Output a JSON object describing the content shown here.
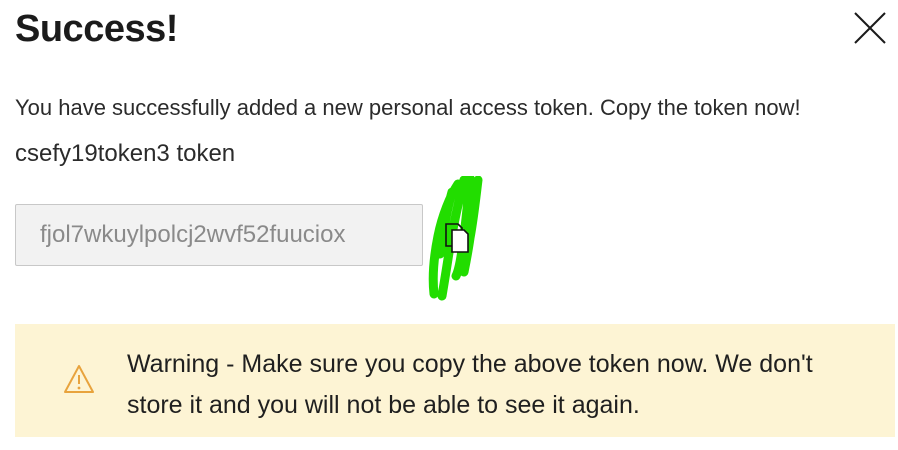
{
  "dialog": {
    "title": "Success!",
    "message": "You have successfully added a new personal access token. Copy the token now!",
    "token_name": "csefy19token3 token",
    "token_value": "fjol7wkuylpolcj2wvf52fuuciox",
    "close_icon": "close-icon",
    "copy_icon": "copy-icon"
  },
  "warning": {
    "icon": "warning-triangle-icon",
    "text": "Warning - Make sure you copy the above token now. We don't store it and you will not be able to see it again.",
    "background": "#fdf4d4",
    "icon_color": "#e8a33d"
  }
}
